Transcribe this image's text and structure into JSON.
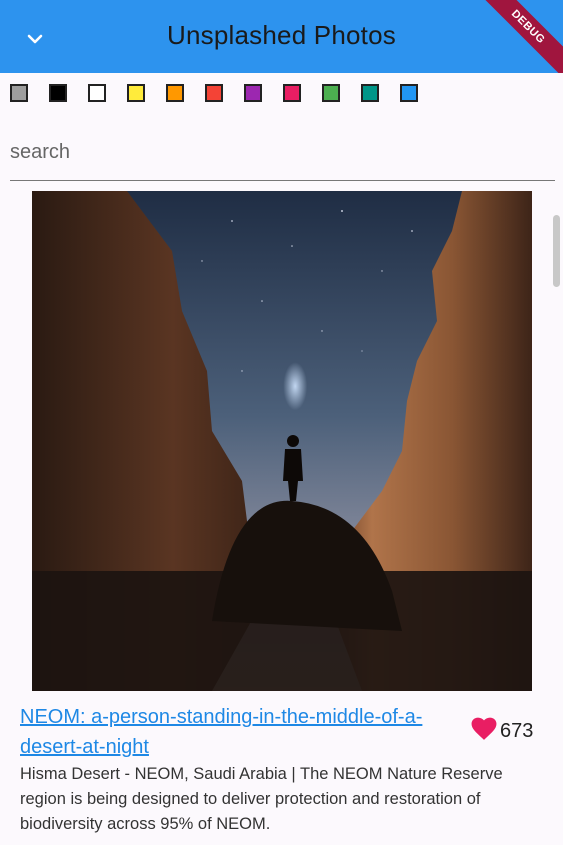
{
  "app_bar": {
    "title": "Unsplashed Photos",
    "back_icon": "chevron-down-icon",
    "debug_banner": "DEBUG",
    "background_color": "#2d93ee"
  },
  "color_filters": [
    {
      "name": "grey",
      "color": "#9e9e9e"
    },
    {
      "name": "black",
      "color": "#000000"
    },
    {
      "name": "white",
      "color": "#ffffff"
    },
    {
      "name": "yellow",
      "color": "#ffeb3b"
    },
    {
      "name": "orange",
      "color": "#ff9800"
    },
    {
      "name": "red",
      "color": "#f44336"
    },
    {
      "name": "purple",
      "color": "#9c27b0"
    },
    {
      "name": "pink",
      "color": "#e91e63"
    },
    {
      "name": "green",
      "color": "#4caf50"
    },
    {
      "name": "teal",
      "color": "#009688"
    },
    {
      "name": "blue",
      "color": "#2196f3"
    }
  ],
  "search": {
    "placeholder": "search",
    "value": ""
  },
  "photo": {
    "title": "NEOM: a-person-standing-in-the-middle-of-a-desert-at-night",
    "likes": "673",
    "like_icon": "heart-icon",
    "description": "Hisma Desert - NEOM, Saudi Arabia | The NEOM Nature Reserve region is being designed to deliver protection and restoration of biodiversity across 95% of NEOM."
  }
}
